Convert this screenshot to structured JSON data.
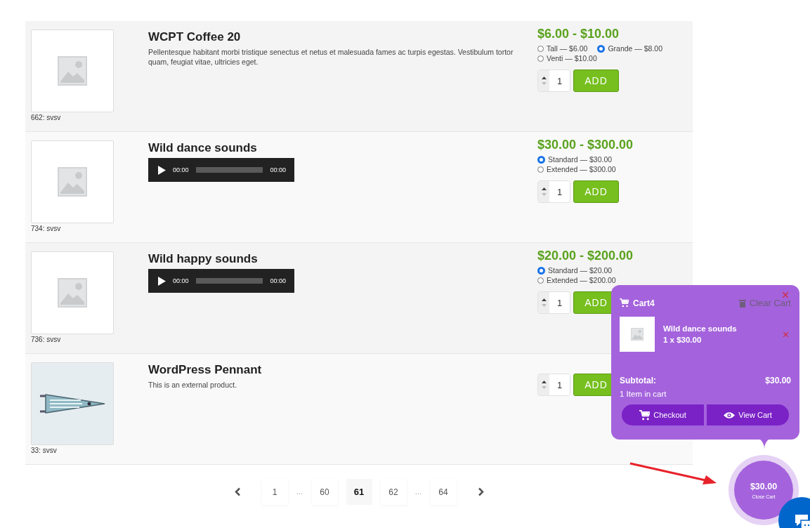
{
  "products": [
    {
      "image": {
        "kind": "placeholder"
      },
      "caption": "662: svsv",
      "title": "WCPT Coffee 20",
      "description": "Pellentesque habitant morbi tristique senectus et netus et malesuada fames ac turpis egestas. Vestibulum tortor quam, feugiat vitae, ultricies eget.",
      "price_range": "$6.00 - $10.00",
      "variations": [
        {
          "label": "Tall — $6.00",
          "selected": false
        },
        {
          "label": "Grande — $8.00",
          "selected": true
        },
        {
          "label": "Venti — $10.00",
          "selected": false
        }
      ],
      "quantity": "1",
      "add_label": "ADD"
    },
    {
      "image": {
        "kind": "placeholder"
      },
      "caption": "734: svsv",
      "title": "Wild dance sounds",
      "audio": {
        "current": "00:00",
        "duration": "00:00"
      },
      "price_range": "$30.00 - $300.00",
      "variations": [
        {
          "label": "Standard — $30.00",
          "selected": true
        },
        {
          "label": "Extended — $300.00",
          "selected": false
        }
      ],
      "quantity": "1",
      "add_label": "ADD"
    },
    {
      "image": {
        "kind": "placeholder"
      },
      "caption": "736: svsv",
      "title": "Wild happy sounds",
      "audio": {
        "current": "00:00",
        "duration": "00:00"
      },
      "price_range": "$20.00 - $200.00",
      "variations": [
        {
          "label": "Standard — $20.00",
          "selected": true
        },
        {
          "label": "Extended — $200.00",
          "selected": false
        }
      ],
      "quantity": "1",
      "add_label": "ADD"
    },
    {
      "image": {
        "kind": "pennant"
      },
      "caption": "33: svsv",
      "title": "WordPress Pennant",
      "description": "This is an external product.",
      "quantity": "1",
      "add_label": "ADD"
    }
  ],
  "pagination": {
    "pages": [
      {
        "kind": "page",
        "label": "1",
        "selected": false
      },
      {
        "kind": "ellipsis",
        "label": "…"
      },
      {
        "kind": "page",
        "label": "60",
        "selected": false
      },
      {
        "kind": "page",
        "label": "61",
        "selected": true
      },
      {
        "kind": "page",
        "label": "62",
        "selected": false
      },
      {
        "kind": "ellipsis",
        "label": "…"
      },
      {
        "kind": "page",
        "label": "64",
        "selected": false
      }
    ]
  },
  "cart": {
    "title": "Cart4",
    "clear_label": "Clear Cart",
    "items": [
      {
        "name": "Wild dance sounds",
        "line": "1 x $30.00"
      }
    ],
    "subtotal_label": "Subtotal:",
    "subtotal": "$30.00",
    "count_text": "1 Item in cart",
    "buttons": [
      {
        "kind": "checkout",
        "label": "Checkout"
      },
      {
        "kind": "view",
        "label": "View Cart"
      }
    ]
  },
  "cart_toggle": {
    "amount": "$30.00",
    "label": "Close Cart"
  }
}
